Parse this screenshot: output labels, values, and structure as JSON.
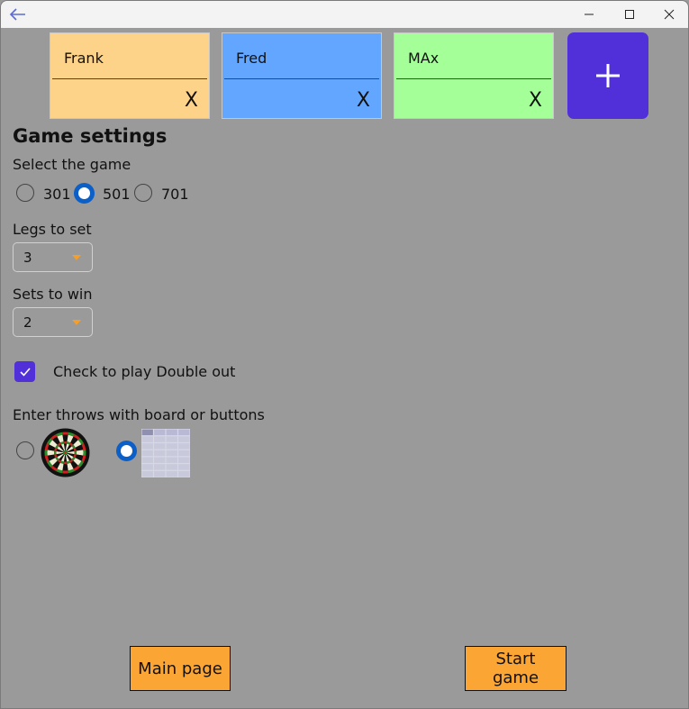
{
  "players": [
    {
      "name": "Frank",
      "remove_label": "X",
      "color": "#fdd38a"
    },
    {
      "name": "Fred",
      "remove_label": "X",
      "color": "#63a6ff"
    },
    {
      "name": "MAx",
      "remove_label": "X",
      "color": "#a4ff99"
    }
  ],
  "add_player_icon": "plus-icon",
  "settings": {
    "title": "Game settings",
    "select_game_label": "Select the game",
    "game_options": [
      "301",
      "501",
      "701"
    ],
    "selected_game": "501",
    "legs_label": "Legs to set",
    "legs_value": "3",
    "sets_label": "Sets to win",
    "sets_value": "2",
    "double_out_label": "Check to play Double out",
    "double_out_checked": true,
    "input_method_label": "Enter throws with board or buttons",
    "input_methods": [
      "dartboard",
      "buttons"
    ],
    "selected_input_method": "buttons"
  },
  "buttons": {
    "main_page": "Main page",
    "start_game": "Start game"
  },
  "colors": {
    "accent": "#5230d9",
    "radio_selected": "#0b5fc7",
    "bottom_button": "#fba534",
    "dropdown_caret": "#f59e28",
    "background": "#9a9a9a"
  }
}
